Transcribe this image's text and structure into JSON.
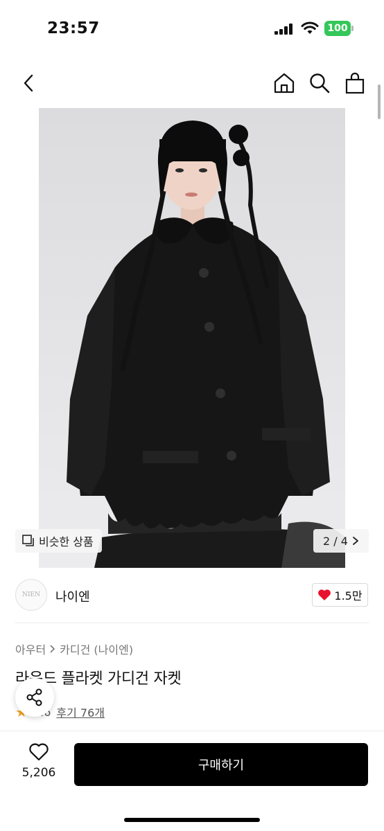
{
  "status": {
    "time": "23:57",
    "battery": "100"
  },
  "nav": {
    "back_icon": "chevron-left-icon",
    "home_icon": "home-icon",
    "search_icon": "search-icon",
    "bag_icon": "shopping-bag-icon"
  },
  "gallery": {
    "similar_label": "비슷한 상품",
    "page": "2 / 4"
  },
  "brand": {
    "logo_text": "NIEN",
    "name": "나이엔",
    "likes": "1.5만"
  },
  "product": {
    "category_primary": "아우터",
    "category_secondary": "카디건 (나이엔)",
    "title": "라운드 플라켓 가디건 자켓",
    "rating": "4.6",
    "reviews": "후기 76개"
  },
  "bottom": {
    "wish_count": "5,206",
    "buy_label": "구매하기"
  },
  "colors": {
    "battery": "#34c759",
    "heart": "#e8112d",
    "buy_button": "#000000",
    "star": "#f5a623"
  }
}
